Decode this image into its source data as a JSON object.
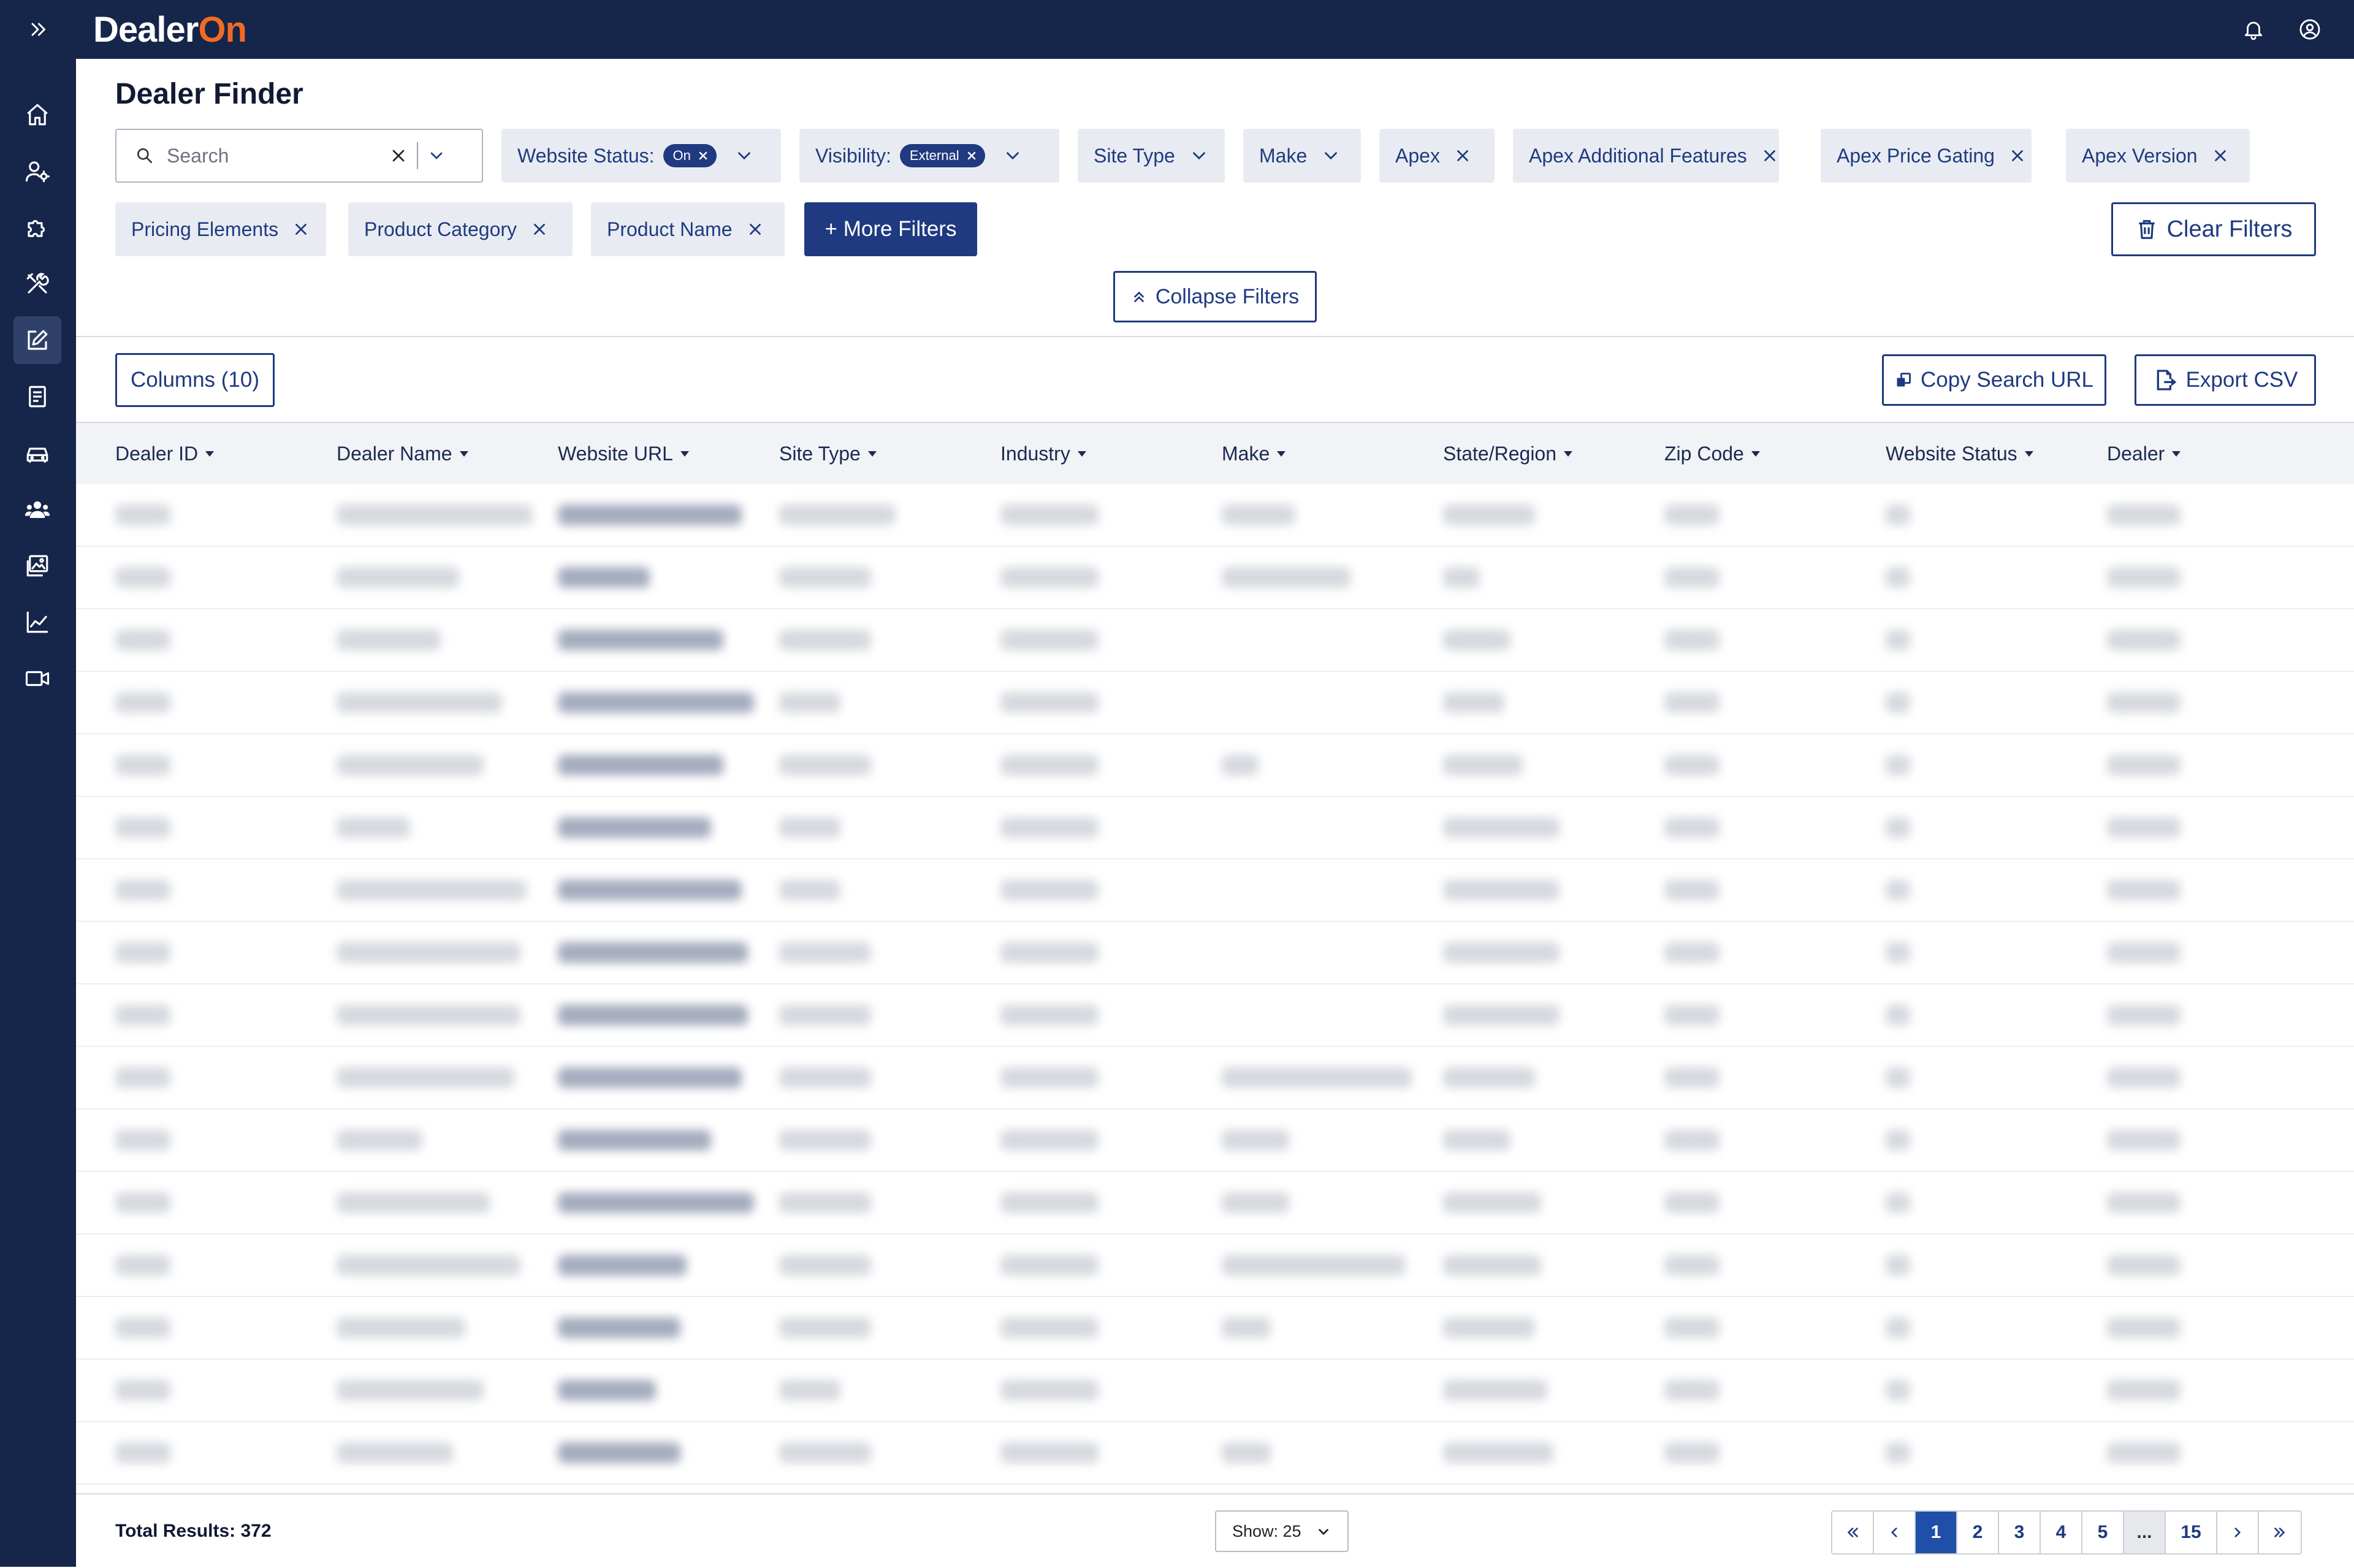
{
  "app": {
    "logo_text_a": "Dealer",
    "logo_text_b": "On",
    "page_title": "Dealer Finder"
  },
  "colors": {
    "navy": "#16254a",
    "brand_orange": "#f26a21",
    "primary_blue": "#1f3a80",
    "chip_bg": "#e8ecf2"
  },
  "sidebar": {
    "items": [
      {
        "icon": "home-icon"
      },
      {
        "icon": "user-settings-icon"
      },
      {
        "icon": "puzzle-icon"
      },
      {
        "icon": "tools-icon"
      },
      {
        "icon": "edit-icon",
        "active": true
      },
      {
        "icon": "document-icon"
      },
      {
        "icon": "car-icon"
      },
      {
        "icon": "users-icon"
      },
      {
        "icon": "image-icon"
      },
      {
        "icon": "chart-line-icon"
      },
      {
        "icon": "video-icon"
      }
    ]
  },
  "search": {
    "placeholder": "Search",
    "value": ""
  },
  "filters": {
    "website_status": {
      "label": "Website Status:",
      "value": "On"
    },
    "visibility": {
      "label": "Visibility:",
      "value": "External"
    },
    "site_type": "Site Type",
    "make": "Make",
    "apex": "Apex",
    "apex_additional_features": "Apex Additional Features",
    "apex_price_gating": "Apex Price Gating",
    "apex_version": "Apex Version",
    "pricing_elements": "Pricing Elements",
    "product_category": "Product Category",
    "product_name": "Product Name",
    "more_filters": "+ More Filters",
    "clear_filters": "Clear Filters",
    "collapse_filters": "Collapse Filters"
  },
  "toolbar": {
    "columns": "Columns (10)",
    "copy_search_url": "Copy Search URL",
    "export_csv": "Export CSV"
  },
  "table": {
    "columns": [
      "Dealer ID",
      "Dealer Name",
      "Website URL",
      "Site Type",
      "Industry",
      "Make",
      "State/Region",
      "Zip Code",
      "Website Status",
      "Dealer"
    ],
    "blurred_rows": 16
  },
  "footer": {
    "total_results": "Total Results: 372",
    "show": "Show: 25",
    "pages": [
      "1",
      "2",
      "3",
      "4",
      "5",
      "...",
      "15"
    ],
    "current_page": "1"
  }
}
